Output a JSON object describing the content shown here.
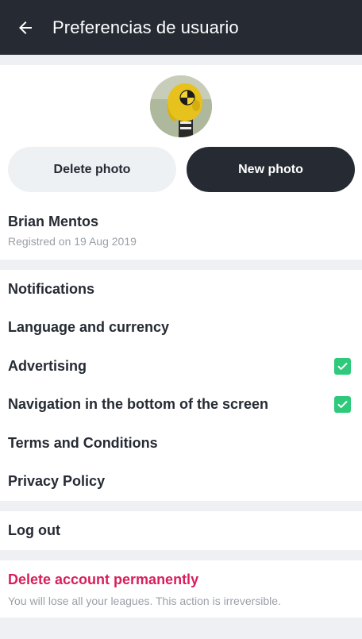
{
  "appbar": {
    "title": "Preferencias de usuario",
    "back_icon": "arrow-left-icon"
  },
  "profile": {
    "avatar_icon": "crash-test-dummy-avatar",
    "delete_photo_label": "Delete photo",
    "new_photo_label": "New photo",
    "name": "Brian Mentos",
    "registered": "Registred on 19 Aug 2019"
  },
  "settings": {
    "items": [
      {
        "label": "Notifications",
        "checked": false
      },
      {
        "label": "Language and currency",
        "checked": false
      },
      {
        "label": "Advertising",
        "checked": true
      },
      {
        "label": "Navigation in the bottom of the screen",
        "checked": true
      },
      {
        "label": "Terms and Conditions",
        "checked": false
      },
      {
        "label": "Privacy Policy",
        "checked": false
      }
    ]
  },
  "logout": {
    "label": "Log out"
  },
  "delete_account": {
    "title": "Delete account permanently",
    "description": "You will lose all your leagues. This action is irreversible."
  },
  "colors": {
    "appbar_bg": "#252a33",
    "accent_green": "#2ec97a",
    "danger": "#d81f5b",
    "muted_text": "#9aa0a8",
    "page_bg": "#eef0f3"
  }
}
